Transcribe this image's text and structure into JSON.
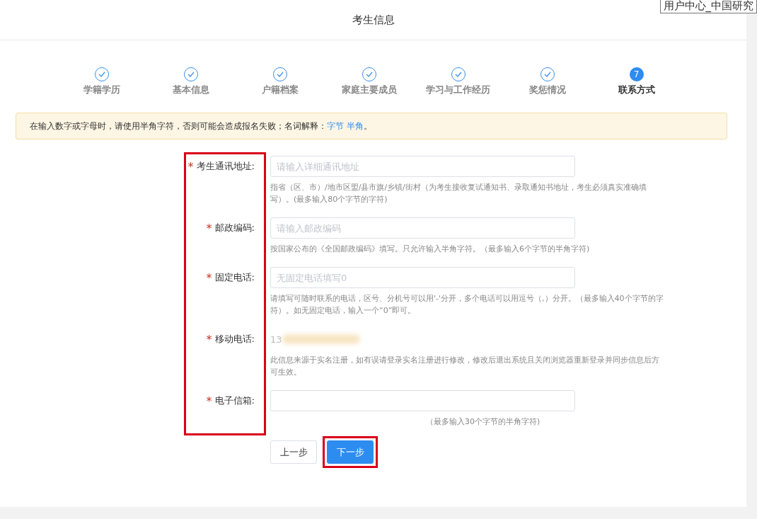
{
  "header": {
    "title": "考生信息"
  },
  "tooltip": "用户中心_中国研究",
  "steps": [
    {
      "label": "学籍学历",
      "kind": "done",
      "selected": false
    },
    {
      "label": "基本信息",
      "kind": "done",
      "selected": false
    },
    {
      "label": "户籍档案",
      "kind": "done",
      "selected": false
    },
    {
      "label": "家庭主要成员",
      "kind": "done",
      "selected": false
    },
    {
      "label": "学习与工作经历",
      "kind": "done",
      "selected": false
    },
    {
      "label": "奖惩情况",
      "kind": "done",
      "selected": false
    },
    {
      "label": "联系方式",
      "kind": "current",
      "number": "7",
      "selected": true
    }
  ],
  "notice": {
    "text": "在输入数字或字母时，请使用半角字符，否则可能会造成报名失败；名词解释：",
    "links": [
      "字节",
      "半角"
    ],
    "end": "。"
  },
  "fields": [
    {
      "label": "考生通讯地址:",
      "mark": "*",
      "kind": "input",
      "placeholder": "请输入详细通讯地址",
      "hint": "指省（区、市）/地市区盟/县市旗/乡镇/街村（为考生接收复试通知书、录取通知书地址，考生必须真实准确填写）。(最多输入80个字节的字符)"
    },
    {
      "label": "邮政编码:",
      "mark": "*",
      "kind": "input",
      "placeholder": "请输入邮政编码",
      "hint": "按国家公布的《全国邮政编码》填写。只允许输入半角字符。（最多输入6个字节的半角字符)"
    },
    {
      "label": "固定电话:",
      "mark": "*",
      "kind": "input",
      "placeholder": "无固定电话填写0",
      "hint": "请填写可随时联系的电话，区号、分机号可以用'-'分开，多个电话可以用逗号（,）分开。（最多输入40个字节的字符）。如无固定电话，输入一个“0”即可。"
    },
    {
      "label": "移动电话:",
      "mark": "*",
      "kind": "static",
      "value": "13",
      "hint": "此信息来源于实名注册，如有误请登录实名注册进行修改，修改后退出系统且关闭浏览器重新登录并同步信息后方可生效。"
    },
    {
      "label": "电子信箱:",
      "mark": "*",
      "kind": "input",
      "hint": "（最多输入30个字节的半角字符)"
    }
  ],
  "buttons": [
    {
      "label": "上一步",
      "kind": "default",
      "highlighted": false
    },
    {
      "label": "下一步",
      "kind": "primary",
      "highlighted": true
    }
  ]
}
